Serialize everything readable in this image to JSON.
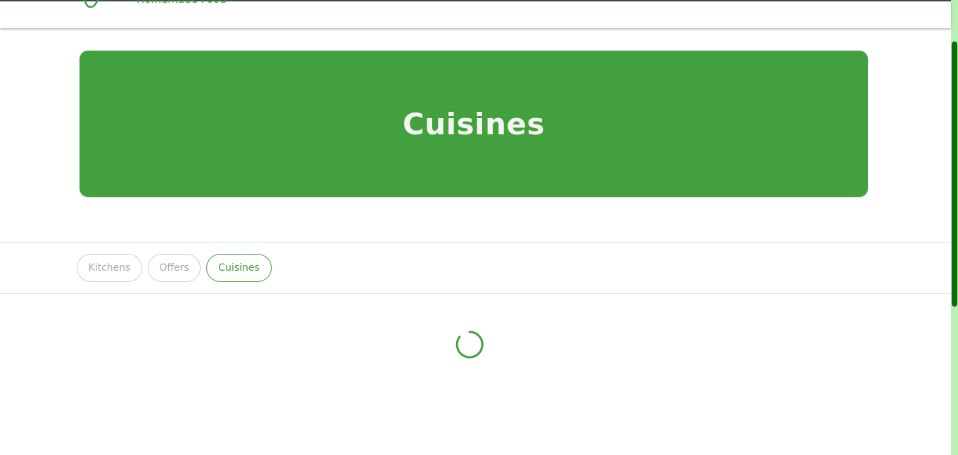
{
  "header": {
    "tagline": "Homemade Food",
    "logo_icon": "bag-leaf-icon"
  },
  "hero": {
    "title": "Cuisines"
  },
  "tabs": [
    {
      "label": "Kitchens",
      "active": false
    },
    {
      "label": "Offers",
      "active": false
    },
    {
      "label": "Cuisines",
      "active": true
    }
  ],
  "loading": {
    "icon": "loading-spinner-icon"
  },
  "colors": {
    "accent": "#43a03f",
    "hero_text": "#f2f6ef",
    "inactive_tab_text": "#a9a9a9",
    "scrollbar_track": "#b9f0b5",
    "scrollbar_thumb": "#0b6e0b"
  }
}
